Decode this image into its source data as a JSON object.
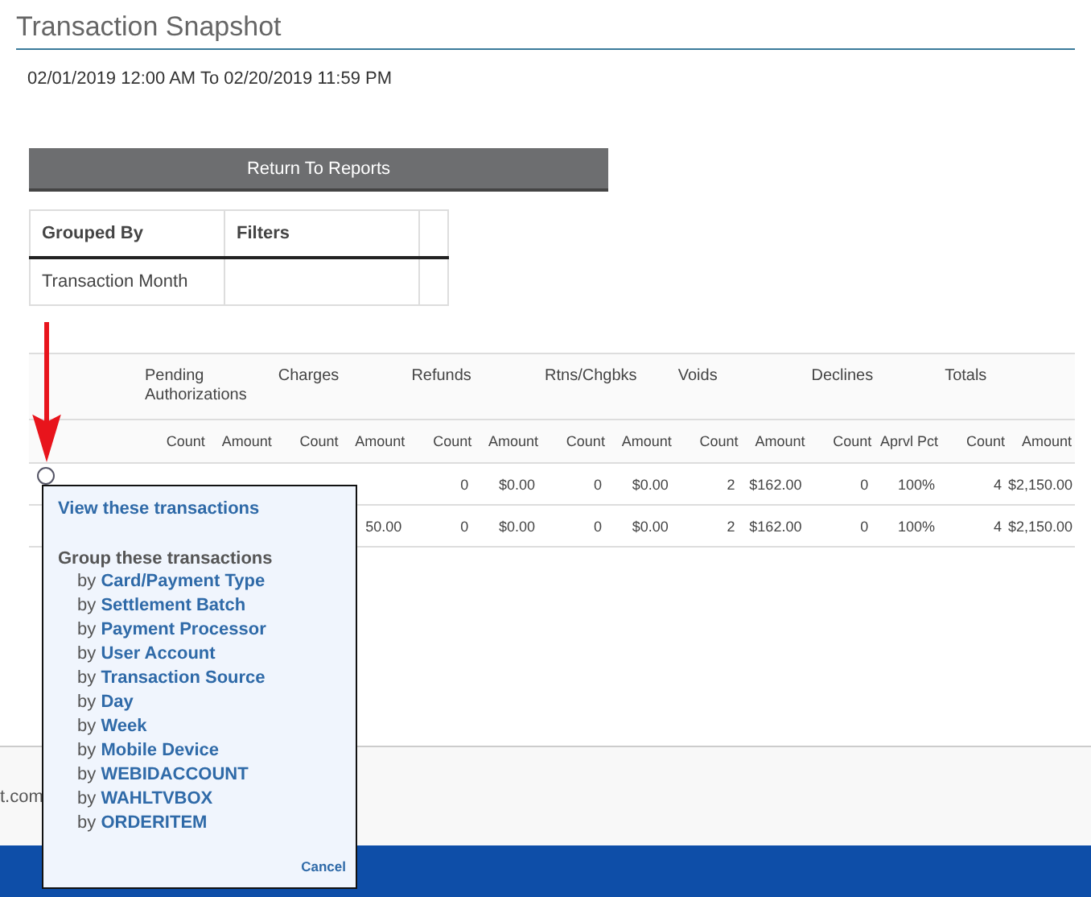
{
  "page": {
    "title": "Transaction Snapshot",
    "date_range": "02/01/2019 12:00 AM To 02/20/2019 11:59 PM"
  },
  "return_button": {
    "label": "Return To Reports"
  },
  "summary_table": {
    "columns": [
      "Grouped By",
      "Filters"
    ],
    "rows": [
      {
        "grouped_by": "Transaction Month"
      }
    ]
  },
  "report_table": {
    "groups": [
      "Pending Authorizations",
      "Charges",
      "Refunds",
      "Rtns/Chgbks",
      "Voids",
      "Declines",
      "Totals"
    ],
    "subcolumns": [
      "Count",
      "Amount",
      "Count",
      "Amount",
      "Count",
      "Amount",
      "Count",
      "Amount",
      "Count",
      "Amount",
      "Count",
      "Aprvl Pct",
      "Count",
      "Amount"
    ],
    "rows": [
      {
        "selected": false,
        "cells": [
          null,
          null,
          null,
          null,
          null,
          "0",
          "$0.00",
          "0",
          "$0.00",
          "2",
          "$162.00",
          "0",
          "100%",
          "4",
          "$2,150.00"
        ]
      },
      {
        "cells": [
          null,
          null,
          null,
          null,
          "50.00",
          "0",
          "$0.00",
          "0",
          "$0.00",
          "2",
          "$162.00",
          "0",
          "100%",
          "4",
          "$2,150.00"
        ]
      }
    ]
  },
  "popup": {
    "view_link": "View these transactions",
    "group_heading": "Group these transactions",
    "options": [
      {
        "prefix": "by",
        "label": "Card/Payment Type"
      },
      {
        "prefix": "by",
        "label": "Settlement Batch"
      },
      {
        "prefix": "by",
        "label": "Payment Processor"
      },
      {
        "prefix": "by",
        "label": "User Account"
      },
      {
        "prefix": "by",
        "label": "Transaction Source"
      },
      {
        "prefix": "by",
        "label": "Day"
      },
      {
        "prefix": "by",
        "label": "Week"
      },
      {
        "prefix": "by",
        "label": "Mobile Device"
      },
      {
        "prefix": "by",
        "label": "WEBIDACCOUNT"
      },
      {
        "prefix": "by",
        "label": "WAHLTVBOX"
      },
      {
        "prefix": "by",
        "label": "ORDERITEM"
      }
    ],
    "cancel": "Cancel"
  },
  "footer": {
    "text": "t.com"
  }
}
